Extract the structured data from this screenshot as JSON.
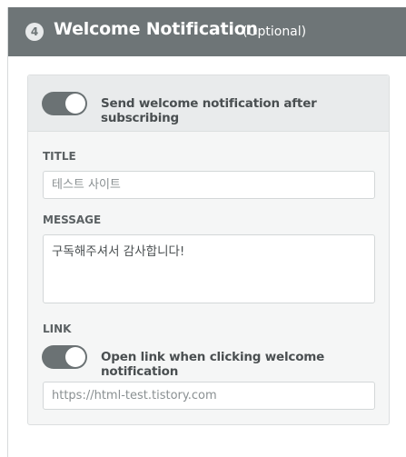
{
  "header": {
    "step_number": "4",
    "title": "Welcome Notification",
    "optional_label": "(Optional)"
  },
  "send_welcome": {
    "enabled": true,
    "label": "Send welcome notification after subscribing"
  },
  "title_field": {
    "label": "TITLE",
    "placeholder": "테스트 사이트",
    "value": ""
  },
  "message_field": {
    "label": "MESSAGE",
    "value": "구독해주셔서 감사합니다!"
  },
  "link_field": {
    "label": "LINK",
    "toggle_enabled": true,
    "toggle_label": "Open link when clicking welcome notification",
    "placeholder": "https://html-test.tistory.com",
    "value": ""
  },
  "colors": {
    "header_bg": "#6e7577",
    "toggle_on": "#6b7274",
    "card_bg": "#f5f6f6"
  }
}
